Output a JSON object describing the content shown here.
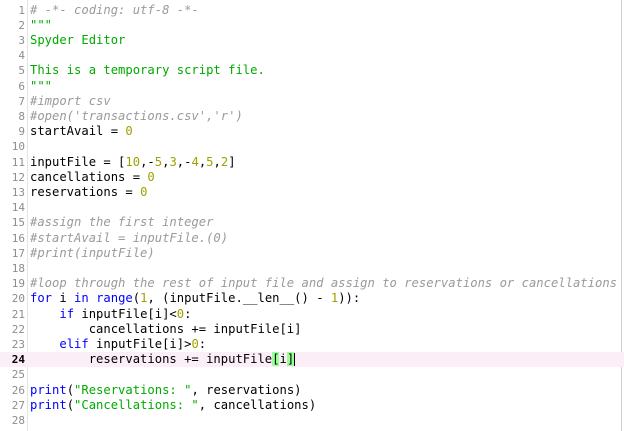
{
  "editor": {
    "current_line": 24,
    "colors": {
      "comment": "#9a9a9a",
      "string": "#00aa00",
      "keyword": "#0000ff",
      "number": "#a0a000",
      "current_line_bg": "#fbeef7",
      "bracket_match_bg": "#99ff99"
    },
    "lines": [
      {
        "n": "1",
        "tokens": [
          {
            "t": "# -*- coding: utf-8 -*-",
            "c": "comment"
          }
        ]
      },
      {
        "n": "2",
        "tokens": [
          {
            "t": "\"\"\"",
            "c": "string"
          }
        ]
      },
      {
        "n": "3",
        "tokens": [
          {
            "t": "Spyder Editor",
            "c": "string"
          }
        ]
      },
      {
        "n": "4",
        "tokens": []
      },
      {
        "n": "5",
        "tokens": [
          {
            "t": "This is a temporary script file.",
            "c": "string"
          }
        ]
      },
      {
        "n": "6",
        "tokens": [
          {
            "t": "\"\"\"",
            "c": "string"
          }
        ]
      },
      {
        "n": "7",
        "tokens": [
          {
            "t": "#import csv",
            "c": "comment"
          }
        ]
      },
      {
        "n": "8",
        "tokens": [
          {
            "t": "#open('transactions.csv','r')",
            "c": "comment"
          }
        ]
      },
      {
        "n": "9",
        "tokens": [
          {
            "t": "startAvail = ",
            "c": ""
          },
          {
            "t": "0",
            "c": "number"
          }
        ]
      },
      {
        "n": "10",
        "tokens": []
      },
      {
        "n": "11",
        "tokens": [
          {
            "t": "inputFile = [",
            "c": ""
          },
          {
            "t": "10",
            "c": "number"
          },
          {
            "t": ",-",
            "c": ""
          },
          {
            "t": "5",
            "c": "number"
          },
          {
            "t": ",",
            "c": ""
          },
          {
            "t": "3",
            "c": "number"
          },
          {
            "t": ",-",
            "c": ""
          },
          {
            "t": "4",
            "c": "number"
          },
          {
            "t": ",",
            "c": ""
          },
          {
            "t": "5",
            "c": "number"
          },
          {
            "t": ",",
            "c": ""
          },
          {
            "t": "2",
            "c": "number"
          },
          {
            "t": "]",
            "c": ""
          }
        ]
      },
      {
        "n": "12",
        "tokens": [
          {
            "t": "cancellations = ",
            "c": ""
          },
          {
            "t": "0",
            "c": "number"
          }
        ]
      },
      {
        "n": "13",
        "tokens": [
          {
            "t": "reservations = ",
            "c": ""
          },
          {
            "t": "0",
            "c": "number"
          }
        ]
      },
      {
        "n": "14",
        "tokens": []
      },
      {
        "n": "15",
        "tokens": [
          {
            "t": "#assign the first integer",
            "c": "comment"
          }
        ]
      },
      {
        "n": "16",
        "tokens": [
          {
            "t": "#startAvail = inputFile.(0)",
            "c": "comment"
          }
        ]
      },
      {
        "n": "17",
        "tokens": [
          {
            "t": "#print(inputFile)",
            "c": "comment"
          }
        ]
      },
      {
        "n": "18",
        "tokens": []
      },
      {
        "n": "19",
        "tokens": [
          {
            "t": "#loop through the rest of input file and assign to reservations or cancellations",
            "c": "comment"
          }
        ]
      },
      {
        "n": "20",
        "tokens": [
          {
            "t": "for",
            "c": "keyword"
          },
          {
            "t": " i ",
            "c": ""
          },
          {
            "t": "in",
            "c": "keyword"
          },
          {
            "t": " ",
            "c": ""
          },
          {
            "t": "range",
            "c": "keyword"
          },
          {
            "t": "(",
            "c": ""
          },
          {
            "t": "1",
            "c": "number"
          },
          {
            "t": ", (inputFile.__len__() - ",
            "c": ""
          },
          {
            "t": "1",
            "c": "number"
          },
          {
            "t": ")):",
            "c": ""
          }
        ]
      },
      {
        "n": "21",
        "tokens": [
          {
            "t": "    ",
            "c": ""
          },
          {
            "t": "if",
            "c": "keyword"
          },
          {
            "t": " inputFile[i]<",
            "c": ""
          },
          {
            "t": "0",
            "c": "number"
          },
          {
            "t": ":",
            "c": ""
          }
        ]
      },
      {
        "n": "22",
        "tokens": [
          {
            "t": "        cancellations += inputFile[i]",
            "c": ""
          }
        ]
      },
      {
        "n": "23",
        "tokens": [
          {
            "t": "    ",
            "c": ""
          },
          {
            "t": "elif",
            "c": "keyword"
          },
          {
            "t": " inputFile[i]>",
            "c": ""
          },
          {
            "t": "0",
            "c": "number"
          },
          {
            "t": ":",
            "c": ""
          }
        ]
      },
      {
        "n": "24",
        "tokens": [
          {
            "t": "        reservations += inputFile",
            "c": ""
          },
          {
            "t": "[",
            "c": "bracket"
          },
          {
            "t": "i",
            "c": ""
          },
          {
            "t": "]",
            "c": "bracket"
          }
        ]
      },
      {
        "n": "25",
        "tokens": []
      },
      {
        "n": "26",
        "tokens": [
          {
            "t": "print",
            "c": "keyword"
          },
          {
            "t": "(",
            "c": ""
          },
          {
            "t": "\"Reservations: \"",
            "c": "string"
          },
          {
            "t": ", reservations)",
            "c": ""
          }
        ]
      },
      {
        "n": "27",
        "tokens": [
          {
            "t": "print",
            "c": "keyword"
          },
          {
            "t": "(",
            "c": ""
          },
          {
            "t": "\"Cancellations: \"",
            "c": "string"
          },
          {
            "t": ", cancellations)",
            "c": ""
          }
        ]
      },
      {
        "n": "28",
        "tokens": []
      }
    ]
  }
}
